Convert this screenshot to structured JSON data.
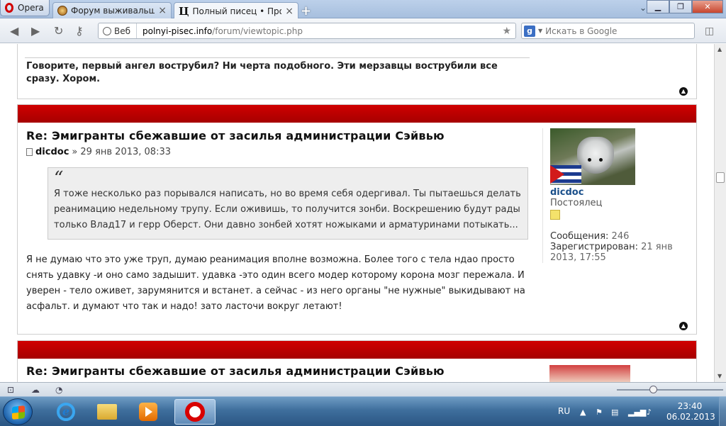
{
  "browser": {
    "menu_label": "Opera",
    "tabs": [
      {
        "title": "Форум выживальщик..."
      },
      {
        "title": "Полный писец • Прос..."
      }
    ],
    "new_tab": "+",
    "address": {
      "chip_label": "Веб",
      "host": "polnyi-pisec.info",
      "path": "/forum/viewtopic.php"
    },
    "search": {
      "engine_letter": "g",
      "placeholder": "Искать в Google"
    }
  },
  "page": {
    "prev_post_tail": "Говорите, первый ангел вострубил? Ни черта подобного. Эти мерзавцы вострубили все сразу. Хором.",
    "post": {
      "title": "Re: Эмигранты сбежавшие от засилья администрации Сэйвью",
      "author": "dicdoc",
      "separator": "»",
      "datetime": "29 янв 2013, 08:33",
      "quote_mark": "“",
      "quote": "Я тоже несколько раз порывался написать, но во время себя одергивал. Ты пытаешься делать реанимацию недельному трупу. Если оживишь, то получится зонби. Воскрешению будут рады только Влад17 и герр Оберст. Они давно зонбей хотят ножыками и арматуринами потыкать...",
      "text": "Я не думаю что это уже труп, думаю реанимация вполне возможна. Более того с тела ндао просто снять удавку -и оно само задышит. удавка -это один всего модер которому корона мозг пережала. И уверен - тело оживет, зарумянится и встанет. а сейчас - из него органы \"не нужные\" выкидывают на асфальт. и думают что так и надо! зато ласточи вокруг летают!",
      "profile": {
        "username": "dicdoc",
        "rank": "Постоялец",
        "posts_label": "Сообщения:",
        "posts_value": "246",
        "registered_label": "Зарегистрирован:",
        "registered_value": "21 янв 2013, 17:55"
      }
    },
    "next_post": {
      "title": "Re: Эмигранты сбежавшие от засилья администрации Сэйвью"
    }
  },
  "taskbar": {
    "language": "RU",
    "time": "23:40",
    "date": "06.02.2013"
  },
  "colors": {
    "post_header_red": "#b00000",
    "username_blue": "#1a4f8a"
  }
}
